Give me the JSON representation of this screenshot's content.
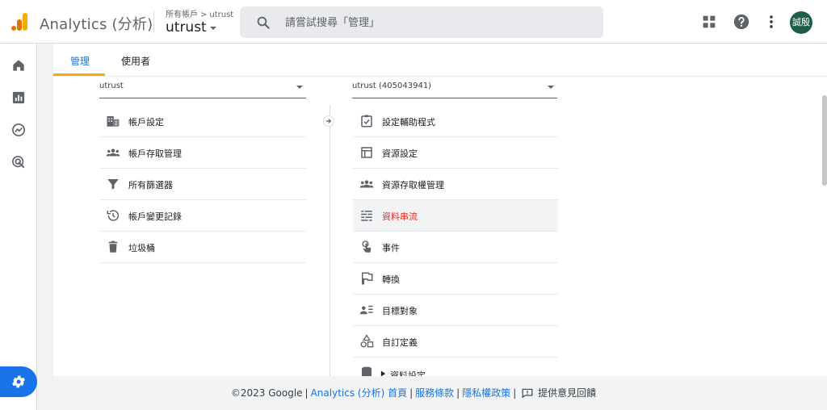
{
  "app": {
    "title": "Analytics (分析)"
  },
  "breadcrumb": {
    "parent": "所有帳戶",
    "separator": ">",
    "current": "utrust"
  },
  "account": {
    "name": "utrust"
  },
  "search": {
    "placeholder": "請嘗試搜尋「管理」"
  },
  "user": {
    "avatar_text": "誠殷",
    "avatar_color": "#1e5e46"
  },
  "tabs": [
    {
      "label": "管理",
      "active": true
    },
    {
      "label": "使用者",
      "active": false
    }
  ],
  "account_column": {
    "selector": "utrust",
    "items": [
      {
        "label": "帳戶設定",
        "icon": "building-icon"
      },
      {
        "label": "帳戶存取管理",
        "icon": "people-icon"
      },
      {
        "label": "所有篩選器",
        "icon": "filter-icon"
      },
      {
        "label": "帳戶變更記錄",
        "icon": "history-icon"
      },
      {
        "label": "垃圾桶",
        "icon": "trash-icon"
      }
    ]
  },
  "property_column": {
    "selector": "utrust (405043941)",
    "items": [
      {
        "label": "設定輔助程式",
        "icon": "checklist-icon"
      },
      {
        "label": "資源設定",
        "icon": "property-icon"
      },
      {
        "label": "資源存取權管理",
        "icon": "people-icon"
      },
      {
        "label": "資料串流",
        "icon": "data-stream-icon",
        "selected": true
      },
      {
        "label": "事件",
        "icon": "touch-icon"
      },
      {
        "label": "轉換",
        "icon": "flag-icon"
      },
      {
        "label": "目標對象",
        "icon": "audience-icon"
      },
      {
        "label": "自訂定義",
        "icon": "shapes-icon"
      },
      {
        "label": "資料設定",
        "icon": "database-icon"
      }
    ]
  },
  "footer": {
    "copyright": "©2023 Google",
    "links": [
      "Analytics (分析) 首頁",
      "服務條款",
      "隱私權政策"
    ],
    "feedback": "提供意見回饋"
  },
  "colors": {
    "accent": "#1a73e8",
    "selected_text": "#d93025",
    "tab_underline": "#f9ab00"
  }
}
